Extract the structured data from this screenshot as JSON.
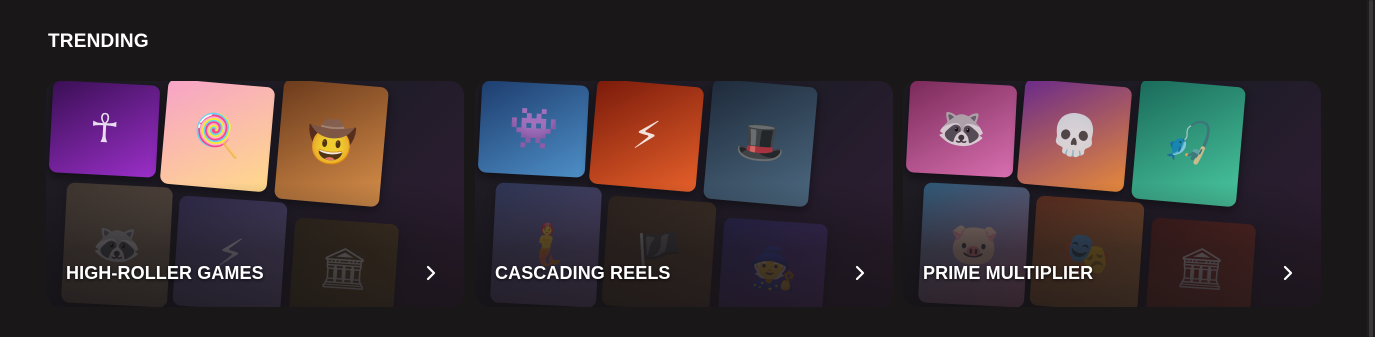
{
  "section": {
    "title": "TRENDING"
  },
  "cards": [
    {
      "label": "HIGH-ROLLER GAMES",
      "chevron_icon": "chevron-right-icon",
      "tiles": [
        {
          "name": "purple-mummy-game-thumbnail",
          "glyph": "☥",
          "colors": [
            "#3a0f55",
            "#9b2fc9"
          ]
        },
        {
          "name": "candy-lollipop-game-thumbnail",
          "glyph": "🍭",
          "colors": [
            "#f7a3c8",
            "#ffd98a"
          ]
        },
        {
          "name": "cowgirl-gunslinger-game-thumbnail",
          "glyph": "🤠",
          "colors": [
            "#6b3a1c",
            "#d9904a"
          ]
        },
        {
          "name": "raccoon-bandit-game-thumbnail",
          "glyph": "🦝",
          "colors": [
            "#5a4a3a",
            "#a08a6a"
          ]
        },
        {
          "name": "zeus-clouds-game-thumbnail",
          "glyph": "⚡",
          "colors": [
            "#3b3566",
            "#9b88c9"
          ]
        },
        {
          "name": "golden-temple-game-thumbnail",
          "glyph": "🏛",
          "colors": [
            "#3a3012",
            "#8a6d22"
          ]
        }
      ]
    },
    {
      "label": "CASCADING REELS",
      "chevron_icon": "chevron-right-icon",
      "tiles": [
        {
          "name": "spiky-monster-game-thumbnail",
          "glyph": "👾",
          "colors": [
            "#1e3d6e",
            "#4d8fc7"
          ]
        },
        {
          "name": "zeus-warrior-game-thumbnail",
          "glyph": "⚡",
          "colors": [
            "#7a1a0a",
            "#e6602a"
          ]
        },
        {
          "name": "gentleman-agent-game-thumbnail",
          "glyph": "🎩",
          "colors": [
            "#1e2a3a",
            "#4d6a82"
          ]
        },
        {
          "name": "sea-goddess-game-thumbnail",
          "glyph": "🧜",
          "colors": [
            "#3a4a7a",
            "#9a7ab9"
          ]
        },
        {
          "name": "pirate-gunner-game-thumbnail",
          "glyph": "🏴",
          "colors": [
            "#3a2a1a",
            "#7a5a32"
          ]
        },
        {
          "name": "witch-wizard-game-thumbnail",
          "glyph": "🧙",
          "colors": [
            "#2a2a6a",
            "#7a4aa8"
          ]
        }
      ]
    },
    {
      "label": "PRIME MULTIPLIER",
      "chevron_icon": "chevron-right-icon",
      "tiles": [
        {
          "name": "raccoon-gangster-game-thumbnail",
          "glyph": "🦝",
          "colors": [
            "#7a2a5a",
            "#d970b0"
          ]
        },
        {
          "name": "mariachi-skeleton-game-thumbnail",
          "glyph": "💀",
          "colors": [
            "#6a2a8a",
            "#e68a3a"
          ]
        },
        {
          "name": "fisherman-bigbass-game-thumbnail",
          "glyph": "🎣",
          "colors": [
            "#1a6a5a",
            "#4ac9a0"
          ]
        },
        {
          "name": "pink-police-pig-game-thumbnail",
          "glyph": "🐷",
          "colors": [
            "#3a8ab9",
            "#f08ab0"
          ]
        },
        {
          "name": "carnival-dancer-game-thumbnail",
          "glyph": "🎭",
          "colors": [
            "#8a3a1a",
            "#e6a04a"
          ]
        },
        {
          "name": "red-temple-game-thumbnail",
          "glyph": "🏛",
          "colors": [
            "#5a1a10",
            "#c9502a"
          ]
        }
      ]
    }
  ]
}
